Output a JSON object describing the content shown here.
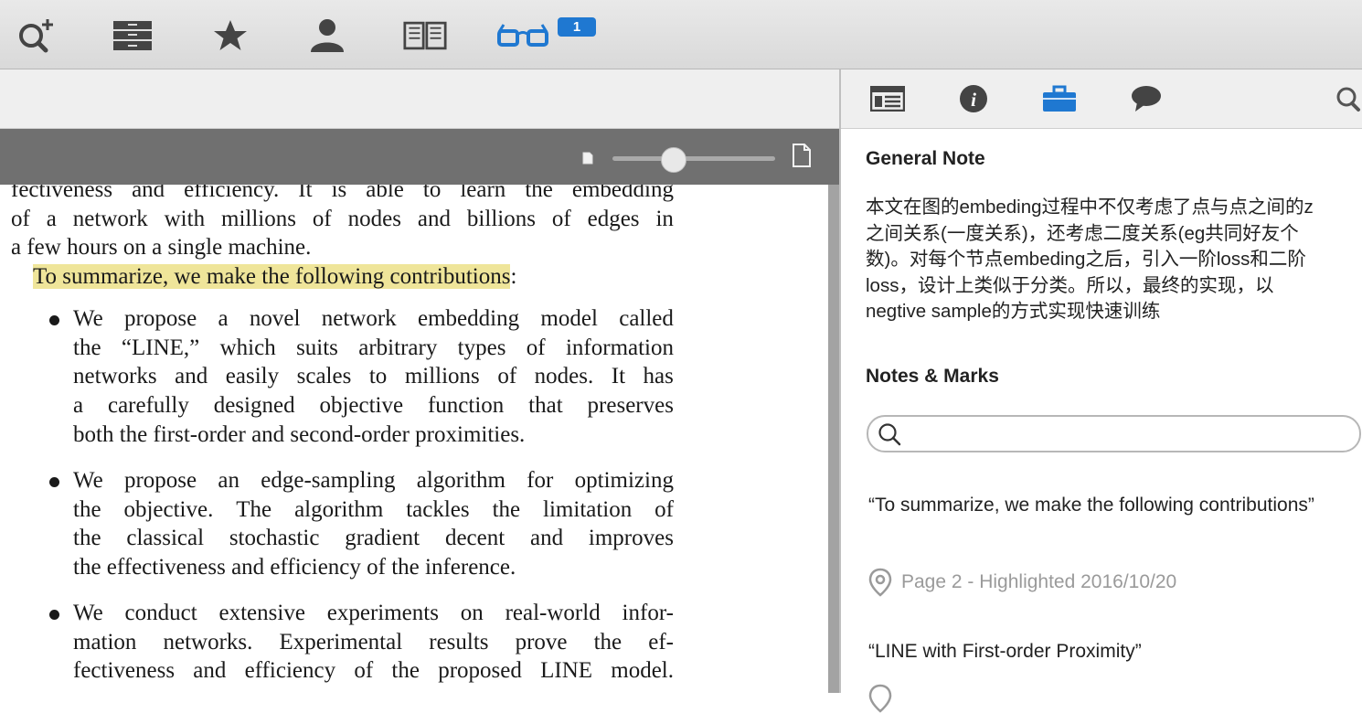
{
  "toolbar": {
    "icons": [
      "search-add-icon",
      "library-icon",
      "star-icon",
      "person-icon",
      "book-icon",
      "reading-glasses-icon"
    ],
    "badge": "1",
    "accent": "#1f78d1"
  },
  "viewer": {
    "zoom_small_icon": "page-small-icon",
    "zoom_large_icon": "page-large-icon",
    "zoom_level": 0.37
  },
  "document": {
    "intro_lines": [
      "fectiveness and efficiency. It is able to learn the embedding",
      "of a network with millions of nodes and billions of edges in",
      "a few hours on a single machine."
    ],
    "highlight": "To summarize, we make the following contributions",
    "highlight_suffix": ":",
    "highlight_color": "#efe59a",
    "bullets": [
      {
        "lines": [
          "We propose a novel network embedding model called",
          "the “LINE,” which suits arbitrary types of information",
          "networks and easily scales to millions of nodes. It has",
          "a carefully designed objective function that preserves",
          "both the first-order and second-order proximities."
        ]
      },
      {
        "lines": [
          "We propose an edge-sampling algorithm for optimizing",
          "the objective. The algorithm tackles the limitation of",
          "the classical stochastic gradient decent and improves",
          "the effectiveness and efficiency of the inference."
        ]
      },
      {
        "lines": [
          "We conduct extensive experiments on real-world infor-",
          "mation networks. Experimental results prove the ef-",
          "fectiveness and efficiency of the proposed LINE model."
        ]
      }
    ]
  },
  "sidebar": {
    "tabs": [
      "table-of-contents-icon",
      "info-icon",
      "briefcase-icon",
      "comment-icon",
      "search-icon"
    ],
    "active_tab": 2,
    "general_note_title": "General Note",
    "general_note_lines": [
      "本文在图的embeding过程中不仅考虑了点与点之间的z",
      "之间关系(一度关系)，还考虑二度关系(eg共同好友个",
      "数)。对每个节点embeding之后，引入一阶loss和二阶",
      "loss，设计上类似于分类。所以，最终的实现，以",
      "negtive sample的方式实现快速训练"
    ],
    "notes_title": "Notes & Marks",
    "search_placeholder": "",
    "notes": [
      {
        "quote": "“To summarize, we make the following contributions”",
        "meta": "Page 2 - Highlighted 2016/10/20"
      },
      {
        "quote": "“LINE with First-order Proximity”"
      }
    ]
  }
}
